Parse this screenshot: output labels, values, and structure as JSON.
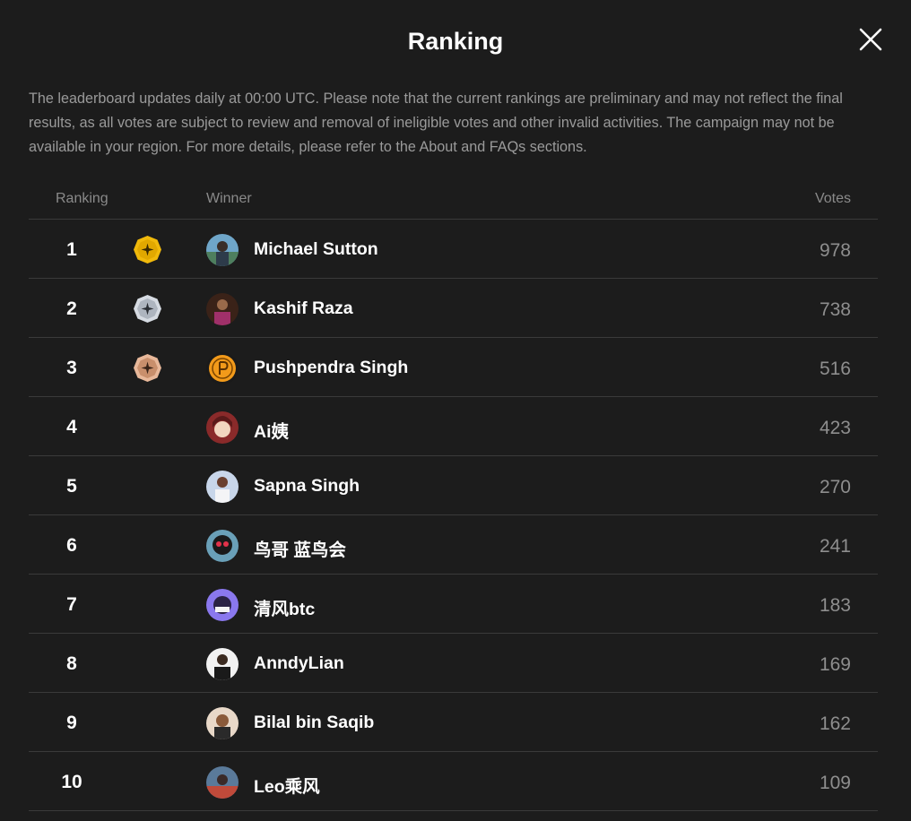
{
  "dialog": {
    "title": "Ranking",
    "notice": "The leaderboard updates daily at 00:00 UTC. Please note that the current rankings are preliminary and may not reflect the final results, as all votes are subject to review and removal of ineligible votes and other invalid activities. The campaign may not be available in your region. For more details, please refer to the About and FAQs sections."
  },
  "table": {
    "headers": {
      "ranking": "Ranking",
      "winner": "Winner",
      "votes": "Votes"
    },
    "rows": [
      {
        "rank": "1",
        "name": "Michael Sutton",
        "votes": "978",
        "medal": "gold"
      },
      {
        "rank": "2",
        "name": "Kashif Raza",
        "votes": "738",
        "medal": "silver"
      },
      {
        "rank": "3",
        "name": "Pushpendra Singh",
        "votes": "516",
        "medal": "bronze"
      },
      {
        "rank": "4",
        "name": "Ai姨",
        "votes": "423"
      },
      {
        "rank": "5",
        "name": "Sapna Singh",
        "votes": "270"
      },
      {
        "rank": "6",
        "name": "鸟哥 蓝鸟会",
        "votes": "241"
      },
      {
        "rank": "7",
        "name": "清风btc",
        "votes": "183"
      },
      {
        "rank": "8",
        "name": "AnndyLian",
        "votes": "169"
      },
      {
        "rank": "9",
        "name": "Bilal bin Saqib",
        "votes": "162"
      },
      {
        "rank": "10",
        "name": "Leo乘风",
        "votes": "109"
      }
    ]
  },
  "icons": {
    "close": "close-icon",
    "medal_gold": "gold-medal-icon",
    "medal_silver": "silver-medal-icon",
    "medal_bronze": "bronze-medal-icon"
  },
  "colors": {
    "background": "#1c1c1c",
    "notice_text": "#9a9a9a",
    "divider": "#3a3a3a",
    "votes_text": "#8e8e8e",
    "gold": "#f0b90b",
    "silver": "#c3c8d0",
    "bronze": "#d9a487"
  }
}
